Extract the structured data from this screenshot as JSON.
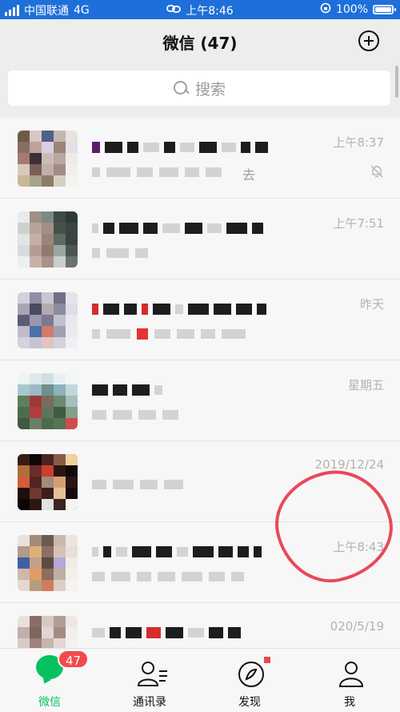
{
  "status_bar": {
    "carrier": "中国联通",
    "network": "4G",
    "time": "上午8:46",
    "battery": "100%"
  },
  "header": {
    "title": "微信 (47)"
  },
  "search": {
    "placeholder": "搜索"
  },
  "chats": [
    {
      "time": "上午8:37",
      "snippet": "去",
      "muted": true
    },
    {
      "time": "上午7:51"
    },
    {
      "time": "昨天"
    },
    {
      "time": "星期五"
    },
    {
      "time": "2019/12/24"
    },
    {
      "time": "上午8:43"
    },
    {
      "time": "020/5/19"
    }
  ],
  "tabs": [
    {
      "label": "微信",
      "icon": "chat-bubble-icon",
      "badge": "47",
      "active": true
    },
    {
      "label": "通讯录",
      "icon": "contacts-icon"
    },
    {
      "label": "发现",
      "icon": "compass-icon"
    },
    {
      "label": "我",
      "icon": "person-icon"
    }
  ],
  "colors": {
    "accent": "#07c160",
    "badge": "#f24a4a",
    "status_bar": "#1e6fd9",
    "annotation": "#e8495a"
  }
}
